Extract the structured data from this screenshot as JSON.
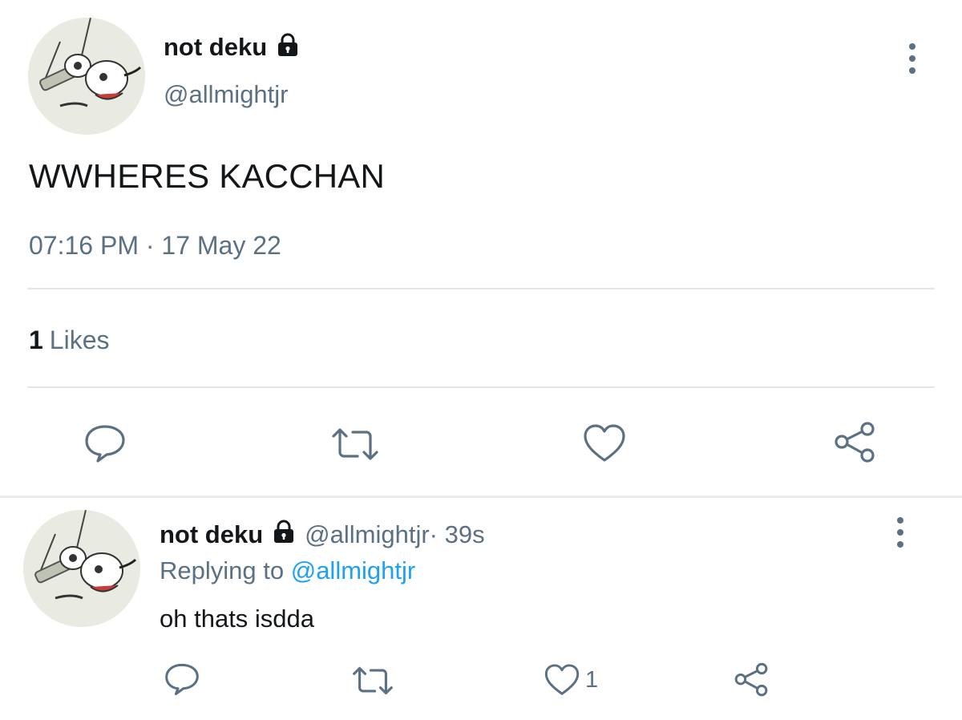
{
  "main_tweet": {
    "display_name": "not deku",
    "handle": "@allmightjr",
    "text": "WWHERES KACCHAN",
    "timestamp": "07:16 PM · 17 May 22",
    "likes_count": "1",
    "likes_label": "Likes"
  },
  "reply": {
    "display_name": "not deku",
    "handle": "@allmightjr",
    "time": " · 39s",
    "replying_prefix": "Replying to ",
    "replying_handle": "@allmightjr",
    "text": "oh thats isdda",
    "like_count": "1"
  },
  "icons": {
    "lock": "lock-icon",
    "more": "more-vertical-icon",
    "reply": "comment-icon",
    "retweet": "retweet-icon",
    "like": "heart-icon",
    "share": "share-icon"
  },
  "colors": {
    "text_primary": "#14171a",
    "text_secondary": "#5b7083",
    "link": "#1da1f2",
    "divider": "#e1e8ed"
  }
}
